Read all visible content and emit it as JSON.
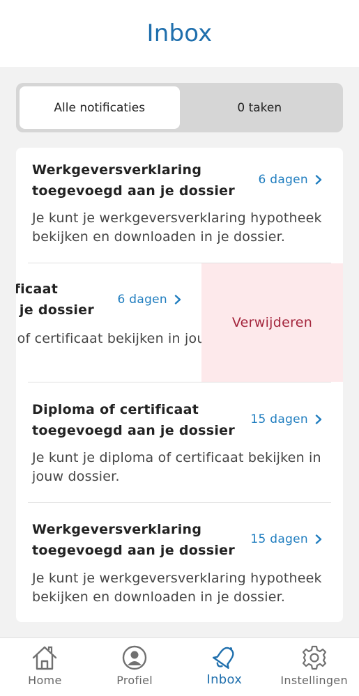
{
  "header": {
    "title": "Inbox"
  },
  "segments": [
    {
      "label": "Alle notificaties",
      "active": true
    },
    {
      "label": "0 taken",
      "active": false
    }
  ],
  "notifications": [
    {
      "title": "Werkgeversverklaring toegevoegd aan je dossier",
      "age": "6 dagen",
      "body": "Je kunt je werkgeversverklaring hypotheek bekijken en downloaden in je dossier."
    },
    {
      "title": "Diploma of certificaat toegevoegd aan je dossier",
      "age": "6 dagen",
      "body": "Je kunt je diploma of certificaat bekijken in jouw dossier.",
      "swiped": true
    },
    {
      "title": "Diploma of certificaat toegevoegd aan je dossier",
      "age": "15 dagen",
      "body": "Je kunt je diploma of certificaat bekijken in jouw dossier."
    },
    {
      "title": "Werkgeversverklaring toegevoegd aan je dossier",
      "age": "15 dagen",
      "body": "Je kunt je werkgeversverklaring hypotheek bekijken en downloaden in je dossier."
    }
  ],
  "swipe_action": {
    "label": "Verwijderen",
    "color": "#a3243b",
    "background": "#fde9eb"
  },
  "tabbar": [
    {
      "label": "Home",
      "icon": "home-icon",
      "active": false
    },
    {
      "label": "Profiel",
      "icon": "profile-icon",
      "active": false
    },
    {
      "label": "Inbox",
      "icon": "bell-icon",
      "active": true
    },
    {
      "label": "Instellingen",
      "icon": "gear-icon",
      "active": false
    }
  ],
  "colors": {
    "accent": "#1f6fad",
    "link": "#1f7dbf",
    "background": "#f2f2f2"
  }
}
